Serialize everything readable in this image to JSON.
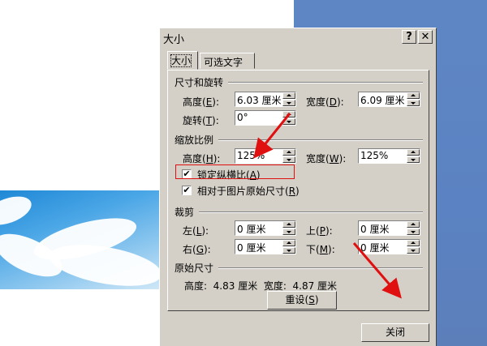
{
  "dialog": {
    "title": "大小",
    "help_button": "?",
    "close_x": "✕",
    "tabs": [
      {
        "label": "大小",
        "active": true
      },
      {
        "label": "可选文字",
        "active": false
      }
    ],
    "size_rotate": {
      "heading": "尺寸和旋转",
      "height_label": "高度(",
      "height_key": "E",
      "height_value": "6.03 厘米",
      "width_label": "宽度(",
      "width_key": "D",
      "width_value": "6.09 厘米",
      "rotate_label": "旋转(",
      "rotate_key": "T",
      "rotate_value": "0°"
    },
    "scale": {
      "heading": "缩放比例",
      "height_label": "高度(",
      "height_key": "H",
      "height_value": "125%",
      "width_label": "宽度(",
      "width_key": "W",
      "width_value": "125%",
      "lock_label": "锁定纵横比(",
      "lock_key": "A",
      "lock_checked": true,
      "relative_label": "相对于图片原始尺寸(",
      "relative_key": "R",
      "relative_checked": true
    },
    "crop": {
      "heading": "裁剪",
      "left_label": "左(",
      "left_key": "L",
      "left_value": "0 厘米",
      "right_label": "右(",
      "right_key": "G",
      "right_value": "0 厘米",
      "top_label": "上(",
      "top_key": "P",
      "top_value": "0 厘米",
      "bottom_label": "下(",
      "bottom_key": "M",
      "bottom_value": "0 厘米"
    },
    "original": {
      "heading": "原始尺寸",
      "summary": "高度:  4.83 厘米  宽度:  4.87 厘米",
      "reset_label": "重设(",
      "reset_key": "S"
    },
    "close_button": "关闭"
  },
  "colors": {
    "dialog_face": "#d4d0c8",
    "desktop_blue": "#5b82c2",
    "annotation_red": "#e01010"
  }
}
